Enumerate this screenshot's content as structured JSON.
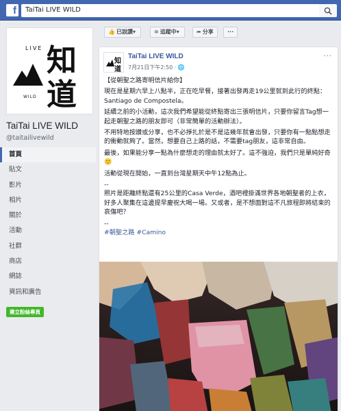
{
  "topbar": {
    "search_value": "TaiTai LIVE WILD"
  },
  "profile": {
    "name": "TaiTai LIVE WILD",
    "handle": "@taitailivewild",
    "logo": {
      "top_text": "LIVE",
      "bottom_text": "WILD",
      "char1": "知",
      "char2": "道"
    }
  },
  "nav": [
    "首頁",
    "貼文",
    "影片",
    "相片",
    "關於",
    "活動",
    "社群",
    "商店",
    "網誌",
    "資訊和廣告"
  ],
  "create_button": "建立粉絲專頁",
  "actions": {
    "liked": "已說讚",
    "following": "追蹤中",
    "share": "分享",
    "more": "···"
  },
  "post": {
    "author": "TaiTai LIVE WILD",
    "time": "7月21日下午2:50 ·",
    "more": "···",
    "paragraphs": [
      "【從朝聖之路寄明信片給你】",
      "現在是星期六早上八點半，正在吃早餐，接著出發再走19公里就到此行的終點：Santiago de Compostela。",
      "延續之前的小活動，這次我們希望能從終點寄出三張明信片，只要你留言Tag想一起走朝聖之路的朋友即可（非常簡單的活動辦法）。",
      "不用特地按讚或分享，也不必掙扎於是不是這幾年就會出發，只要你有一點點想走的衝動就夠了。當然，想要自己上路的話，不需要tag朋友，這非常自由。",
      "最後，如果能分享一點為什麼想走的理由就太好了。這不強迫，我們只是單純好奇 🙂",
      "活動從現在開始，一直到台灣星期天中午12點為止。",
      "--",
      "照片是距離終點還有25公里的Casa Verde，酒吧裡掛滿世界各地朝聖者的上衣，好多人聚集在這邊提早慶祝大喝一場。又或者，是不想面對這不凡旅程即將結束的哀傷吧？",
      "--"
    ],
    "hashtags": "#朝聖之路 #Camino",
    "image_alt": "hanging shirts"
  },
  "colors": {
    "brand": "#4267b2",
    "link": "#385898",
    "create_green": "#42b72a",
    "background": "#e9ebee"
  }
}
